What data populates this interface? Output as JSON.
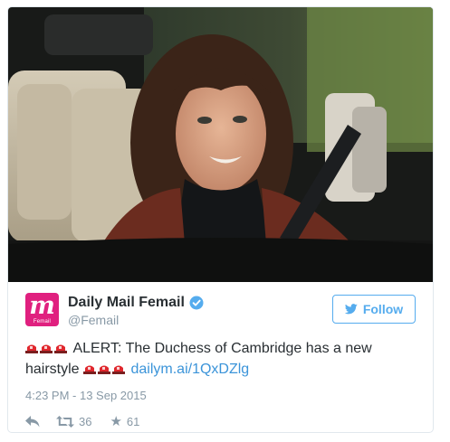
{
  "tweet": {
    "display_name": "Daily Mail Femail",
    "handle": "@Femail",
    "avatar": {
      "letter": "m",
      "caption": "Femail",
      "color": "#e0207f"
    },
    "verified": true,
    "follow_label": "Follow",
    "text_main": "ALERT: The Duchess of Cambridge has a new hairstyle",
    "link_text": "dailym.ai/1QxDZlg",
    "emoji": "rotating-light-icon",
    "timestamp": "4:23 PM - 13 Sep 2015",
    "retweet_count": "36",
    "like_count": "61",
    "colors": {
      "accent": "#55acee",
      "link": "#3b94d9",
      "muted": "#8899a6",
      "text": "#292f33"
    }
  }
}
